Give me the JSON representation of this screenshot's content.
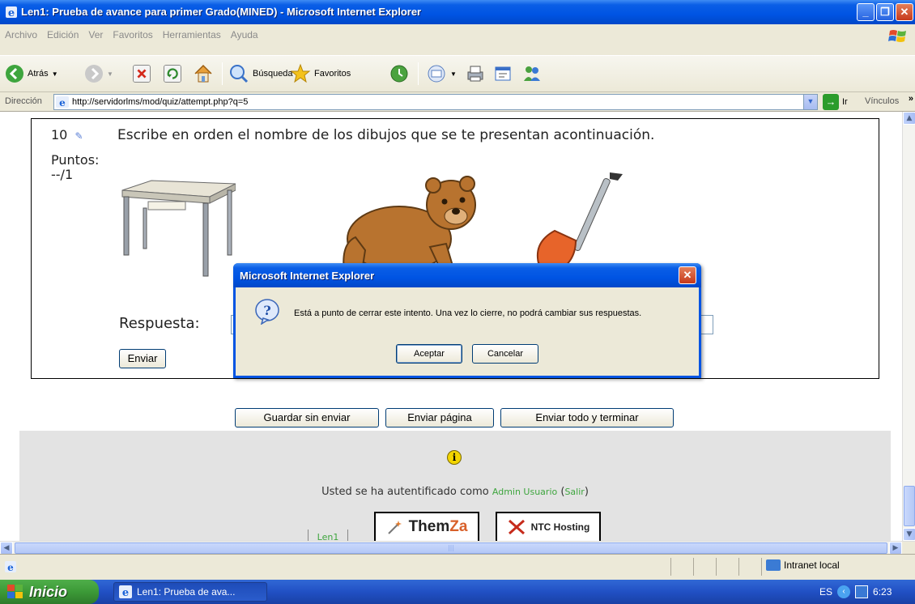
{
  "window": {
    "title": "Len1: Prueba de avance para primer Grado(MINED) - Microsoft Internet Explorer",
    "minimize": "_",
    "maximize": "❐",
    "close": "✕"
  },
  "menu": [
    "Archivo",
    "Edición",
    "Ver",
    "Favoritos",
    "Herramientas",
    "Ayuda"
  ],
  "toolbar": {
    "back": "Atrás",
    "search": "Búsqueda",
    "favorites": "Favoritos"
  },
  "address": {
    "label": "Dirección",
    "url": "http://servidorlms/mod/quiz/attempt.php?q=5",
    "go": "Ir",
    "links": "Vínculos",
    "links_chev": "»"
  },
  "question": {
    "number": "10",
    "points_label": "Puntos:",
    "points_value": "--/1",
    "text": "Escribe en orden el nombre de los dibujos que se te presentan acontinuación.",
    "answer_label": "Respuesta:",
    "answer_value": "",
    "send_label": "Enviar"
  },
  "actions": {
    "save": "Guardar sin enviar",
    "send_page": "Enviar página",
    "send_all": "Enviar todo y terminar"
  },
  "footer": {
    "info_glyph": "i",
    "login_prefix": "Usted se ha autentificado como",
    "user": "Admin Usuario",
    "open_paren": "(",
    "logout": "Salir",
    "close_paren": ")",
    "crumb": "Len1",
    "themza_a": "Them",
    "themza_b": "Za",
    "ntc": "NTC Hosting"
  },
  "status": {
    "zone": "Intranet local"
  },
  "taskbar": {
    "start": "Inicio",
    "task": "Len1: Prueba de ava...",
    "lang": "ES",
    "time": "6:23"
  },
  "dialog": {
    "title": "Microsoft Internet Explorer",
    "message": "Está a punto de cerrar este intento. Una vez lo cierre, no podrá cambiar sus respuestas.",
    "ok": "Aceptar",
    "cancel": "Cancelar",
    "close": "✕"
  },
  "colors": {
    "xp_blue": "#0054e3",
    "link_green": "#3ea53e",
    "start_green": "#3c9a37"
  }
}
